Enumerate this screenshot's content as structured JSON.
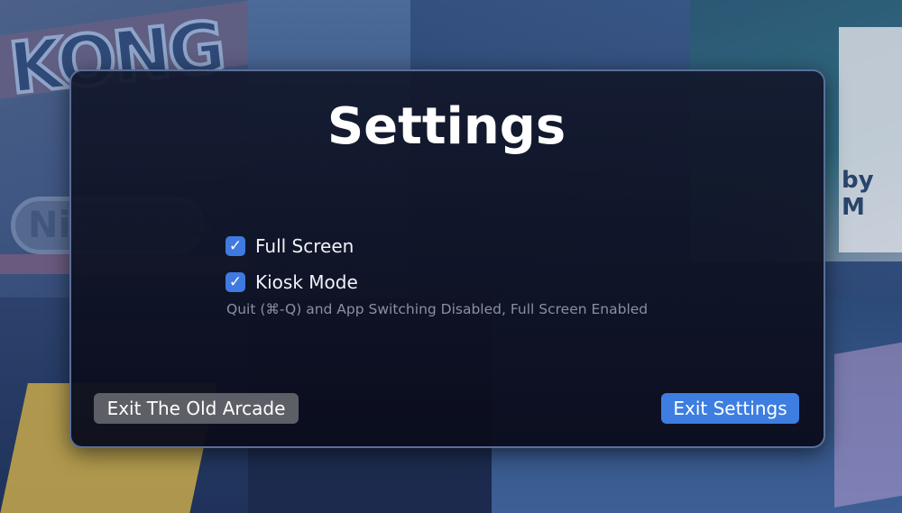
{
  "background": {
    "kong_logo_text": "KONG",
    "nintendo_text": "Nintendo",
    "frogger_by_text": "by M"
  },
  "dialog": {
    "title": "Settings",
    "options": [
      {
        "label": "Full Screen",
        "checked": true
      },
      {
        "label": "Kiosk Mode",
        "checked": true
      }
    ],
    "kiosk_hint": "Quit (⌘-Q) and App Switching Disabled, Full Screen Enabled",
    "buttons": {
      "exit_arcade": "Exit The Old Arcade",
      "exit_settings": "Exit Settings"
    },
    "checkmark_glyph": "✓",
    "colors": {
      "accent": "#3d7ee0",
      "secondary_button": "#5d5f66",
      "hint_text": "#8a90a0"
    }
  }
}
